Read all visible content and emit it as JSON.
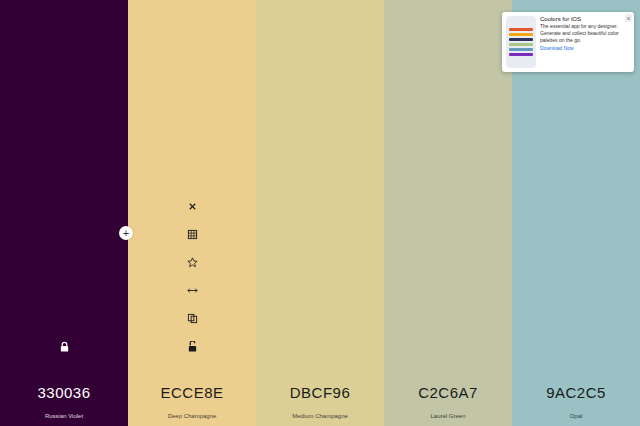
{
  "palette": {
    "colors": [
      {
        "hex": "330036",
        "name": "Russian Violet",
        "color": "#330036",
        "locked": true,
        "toolbar_open": false
      },
      {
        "hex": "ECCE8E",
        "name": "Deep Champagne",
        "color": "#ECCE8E",
        "locked": false,
        "toolbar_open": true
      },
      {
        "hex": "DBCF96",
        "name": "Medium Champagne",
        "color": "#DBCF96",
        "locked": false,
        "toolbar_open": false
      },
      {
        "hex": "C2C6A7",
        "name": "Laurel Green",
        "color": "#C2C6A7",
        "locked": false,
        "toolbar_open": false
      },
      {
        "hex": "9AC2C5",
        "name": "Opal",
        "color": "#9AC2C5",
        "locked": false,
        "toolbar_open": false
      }
    ]
  },
  "add_button": "+",
  "ad": {
    "title": "Coolors for iOS",
    "text": "The essential app for any designer. Generate and collect beautiful color palettes on the go.",
    "cta": "Download Now",
    "close": "x"
  }
}
